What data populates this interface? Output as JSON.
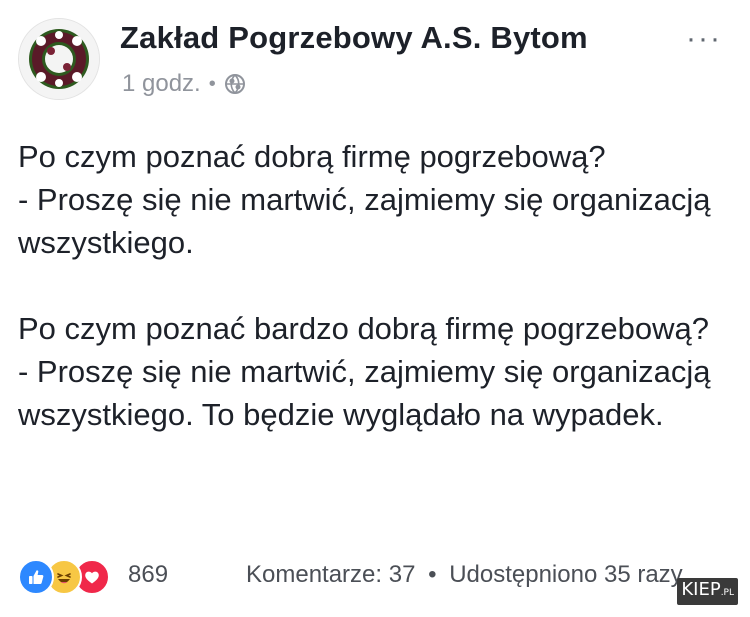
{
  "post": {
    "author": "Zakład Pogrzebowy A.S. Bytom",
    "time": "1 godz.",
    "dot": "•",
    "more": "···",
    "paragraphs": [
      "Po czym poznać dobrą firmę pogrzebową?\n- Proszę się nie martwić, zajmiemy się organizacją wszystkiego.",
      "Po czym poznać bardzo dobrą firmę pogrzebową?\n- Proszę się nie martwić, zajmiemy się organizacją wszystkiego. To będzie wyglądało na wypadek."
    ]
  },
  "footer": {
    "reaction_icons": [
      "like-icon",
      "haha-icon",
      "love-icon"
    ],
    "reaction_count": "869",
    "comments": "Komentarze: 37",
    "dot": "•",
    "shares": "Udostępniono 35 razy"
  },
  "watermark": {
    "main": "KIEP",
    "suffix": ".PL"
  },
  "colors": {
    "like": "#2d88ff",
    "haha": "#f7c744",
    "love": "#f0284a",
    "meta_text": "#90949c"
  }
}
